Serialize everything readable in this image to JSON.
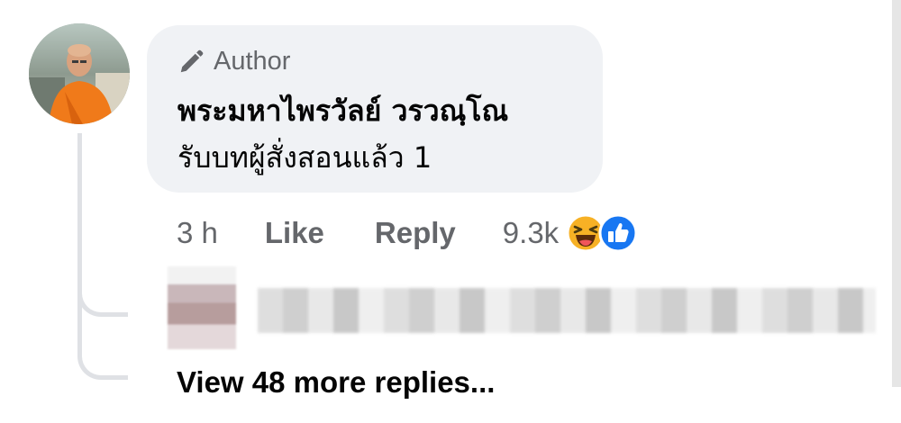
{
  "comment": {
    "badge_label": "Author",
    "author_name": "พระมหาไพรวัลย์ วรวณฺโณ",
    "text": "รับบทผู้สั่งสอนแล้ว 1",
    "avatar_icon": "monk-avatar-photo"
  },
  "actions": {
    "time": "3 h",
    "like_label": "Like",
    "reply_label": "Reply",
    "reaction_count": "9.3k",
    "reactions": [
      "haha-reaction-icon",
      "like-reaction-icon"
    ]
  },
  "replies": {
    "view_more_label": "View 48 more replies..."
  },
  "colors": {
    "bubble_bg": "#f0f2f5",
    "secondary_text": "#65676b",
    "like_blue": "#1877f2",
    "haha_yellow": "#f7b125"
  }
}
